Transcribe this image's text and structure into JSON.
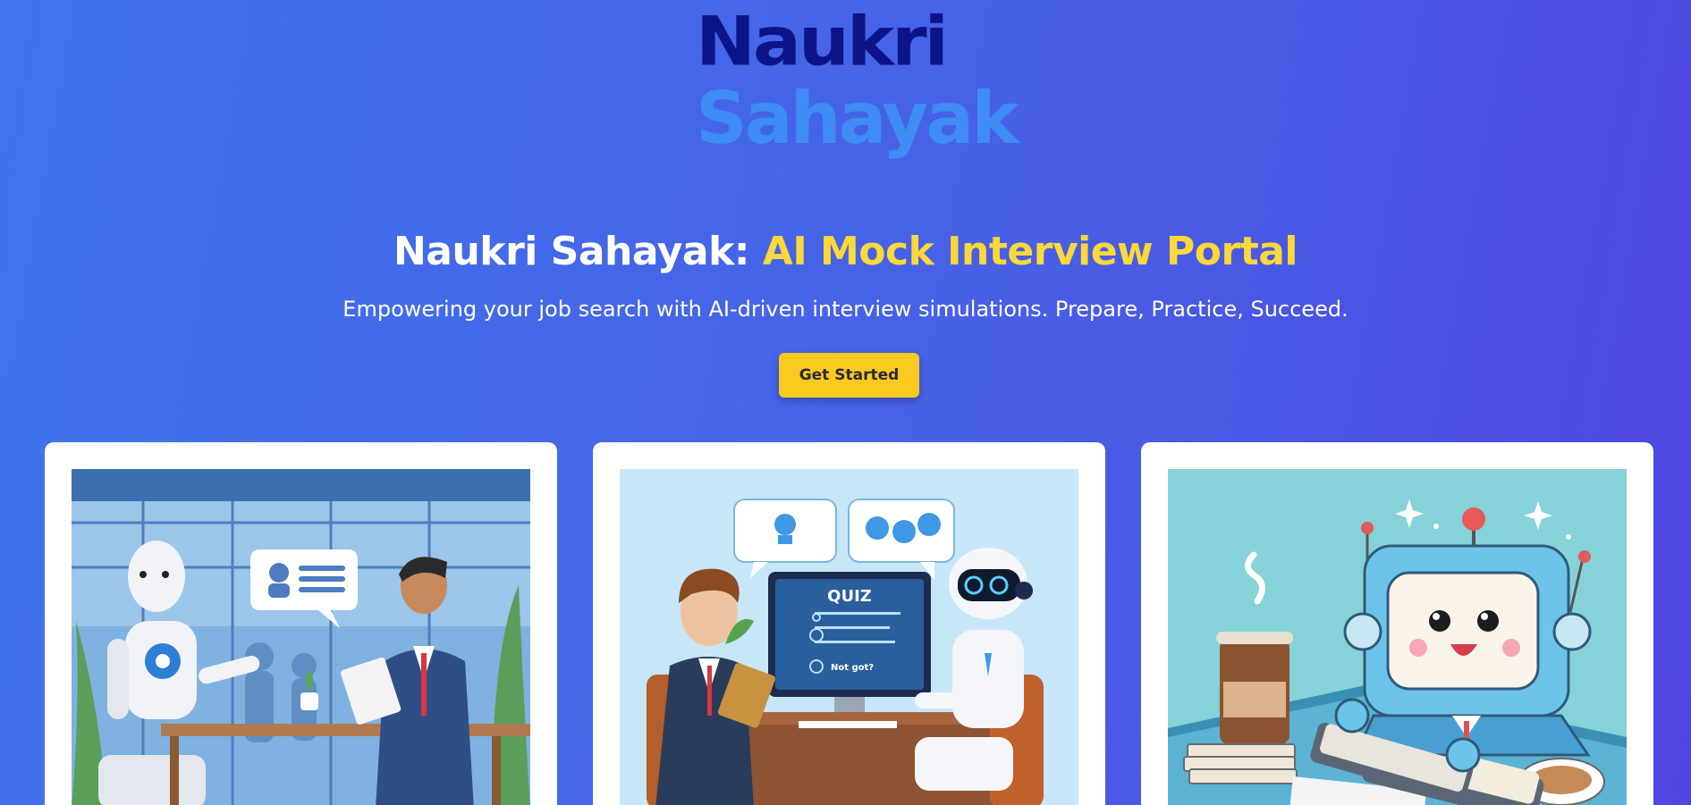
{
  "logo": {
    "line1": "Naukri",
    "line2": "Sahayak"
  },
  "hero": {
    "title_main": "Naukri Sahayak: ",
    "title_accent": "AI Mock Interview Portal",
    "subtitle": "Empowering your job search with AI-driven interview simulations. Prepare, Practice, Succeed.",
    "cta_label": "Get Started"
  },
  "cards": [
    {
      "image": "robot-interviewing-candidate-illustration"
    },
    {
      "image": "robot-quiz-interview-illustration",
      "screen_title": "QUIZ",
      "screen_caption": "Not got?"
    },
    {
      "image": "cute-robot-typing-illustration"
    }
  ],
  "colors": {
    "accent": "#fcd83a",
    "button": "#fbca1f",
    "logo_dark": "#0d1488",
    "logo_light": "#3f8cf5"
  }
}
